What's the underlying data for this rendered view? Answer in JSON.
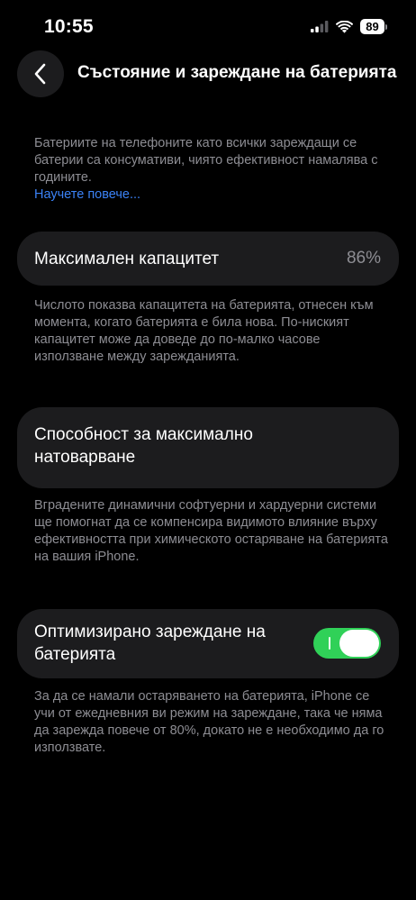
{
  "status_bar": {
    "time": "10:55",
    "battery_level": "89",
    "icons": [
      "cellular-signal-icon",
      "wifi-icon",
      "battery-icon"
    ]
  },
  "header": {
    "back_icon": "chevron-left-icon",
    "title": "Състояние и зареждане на батерията"
  },
  "intro": {
    "text": "Батериите на телефоните като всички зареждащи се батерии са консумативи, чиято ефективност намалява с годините.",
    "link": "Научете повече..."
  },
  "max_capacity": {
    "label": "Максимален капацитет",
    "value": "86%",
    "footnote": "Числото показва капацитета на батерията, отнесен към момента, когато батерията е била нова. По-ниският капацитет може да доведе до по-малко часове използване между зарежданията."
  },
  "peak_performance": {
    "label": "Способност за максимално натоварване",
    "footnote": "Вградените динамични софтуерни и хардуерни системи ще помогнат да се компенсира видимото влияние върху ефективността при химическото остаряване на батерията на вашия iPhone."
  },
  "optimized_charging": {
    "label": "Оптимизирано зареждане на батерията",
    "enabled": true,
    "footnote": "За да се намали остаряването на батерията, iPhone се учи от ежедневния ви режим на зареждане, така че няма да зарежда повече от 80%, докато не е необходимо да го използвате."
  },
  "colors": {
    "background": "#000000",
    "card": "#1c1c1e",
    "secondary_text": "#8d8d93",
    "link": "#3b82f6",
    "toggle_on": "#30d158"
  }
}
